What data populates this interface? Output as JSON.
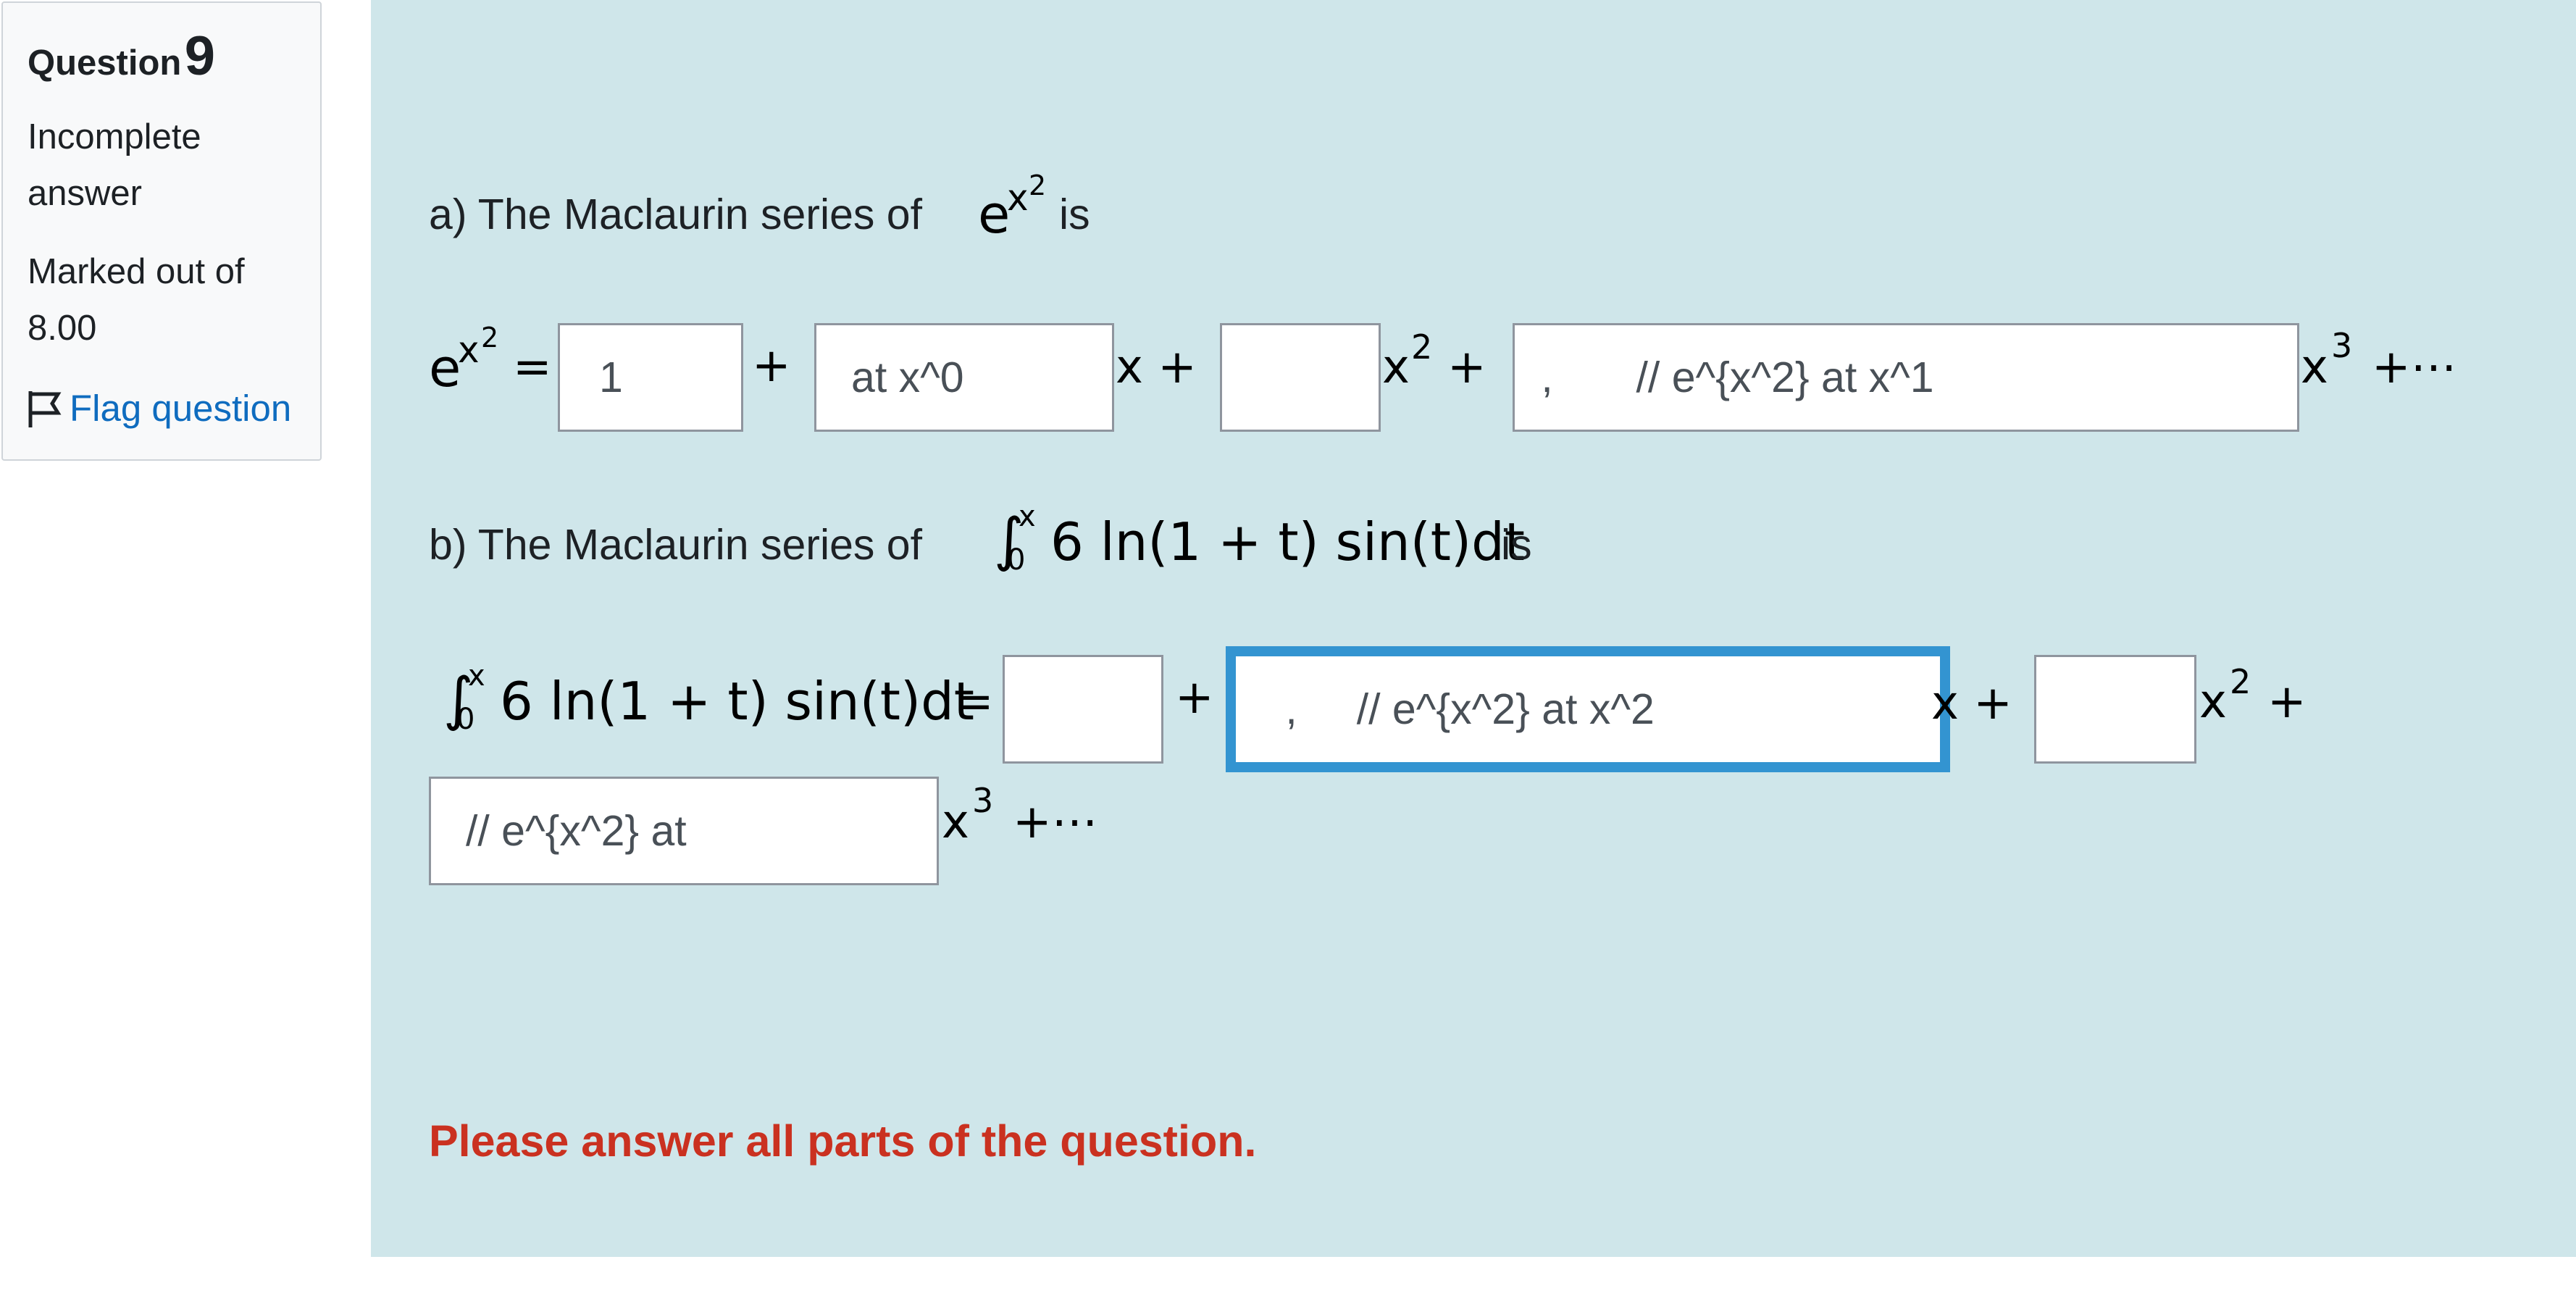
{
  "info": {
    "question_word": "Question",
    "question_number": "9",
    "state": "Incomplete answer",
    "marks": "Marked out of 8.00",
    "flag_label": "Flag question",
    "flag_icon": "flag-outline-icon"
  },
  "part_a": {
    "intro": "a) The Maclaurin series of",
    "intro_expr_base": "e",
    "intro_expr_exp": "x",
    "intro_expr_exp_pow": "2",
    "intro_suffix": "is",
    "lhs_base": "e",
    "lhs_exp": "x",
    "lhs_exp_pow": "2",
    "equals": "=",
    "plus": "+",
    "x_term": "x +",
    "x2_base": "x",
    "x2_pow": "2",
    "x2_tail": "+",
    "x3_base": "x",
    "x3_pow": "3",
    "x3_tail": "+⋯",
    "inputs": [
      {
        "value": "1"
      },
      {
        "value": "at x^0"
      },
      {
        "value": ""
      },
      {
        "value": " ,       // e^{x^2} at x^1"
      }
    ]
  },
  "part_b": {
    "intro": "b) The Maclaurin series of",
    "integral_text": "6 ln(1 + t) sin(t)dt",
    "integral_upper": "x",
    "integral_lower": "0",
    "intro_suffix": "is",
    "equals": "=",
    "plus": "+",
    "x_term": "x +",
    "x2_base": "x",
    "x2_pow": "2",
    "x2_tail": "+",
    "x3_base": "x",
    "x3_pow": "3",
    "x3_tail": "+⋯",
    "inputs": [
      {
        "value": ""
      },
      {
        "value": " ,     // e^{x^2} at x^2"
      },
      {
        "value": ""
      },
      {
        "value": "// e^{x^2} at"
      }
    ]
  },
  "warning": "Please answer all parts of the question.",
  "colors": {
    "formulation_bg": "#cfe6ea",
    "info_bg": "#f8f9fa",
    "link": "#0f6cbf",
    "focus_border": "#3394d1",
    "warning": "#ca3120"
  }
}
